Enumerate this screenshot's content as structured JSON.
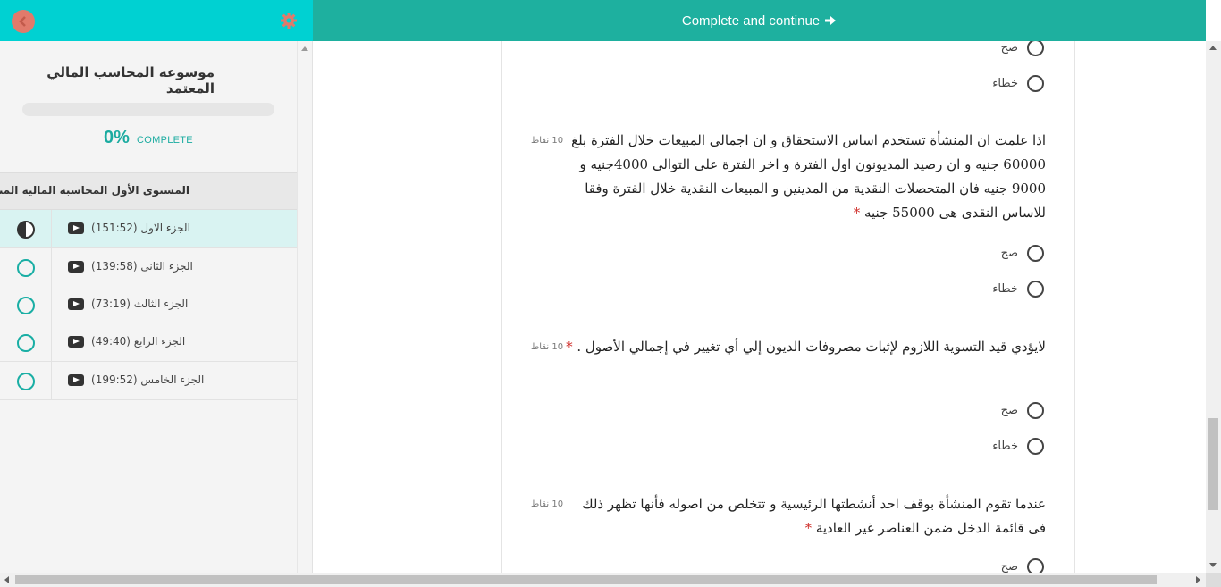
{
  "sidebar": {
    "course_title": "موسوعه المحاسب المالي المعتمد",
    "progress": {
      "percent_value": 0,
      "percent_label": "0%",
      "complete_label": "COMPLETE"
    },
    "section_title": "المستوى الأول المحاسبه الماليه المتقدمه",
    "lessons": [
      {
        "label": "(الجزء الاول (151:52",
        "status": "in-progress"
      },
      {
        "label": "(الجزء الثانى (139:58",
        "status": "not-started"
      },
      {
        "label": "(الجزء الثالث (73:19",
        "status": "not-started"
      },
      {
        "label": "(الجزء الرابع (49:40",
        "status": "not-started"
      },
      {
        "label": "(الجزء الخامس (199:52",
        "status": "not-started"
      }
    ]
  },
  "topbar": {
    "label": "Complete and continue"
  },
  "quiz": {
    "option_true": "صح",
    "option_false": "خطاء",
    "points_label": "10 نقاط",
    "required_mark": "*",
    "questions": [
      {
        "text": "اذا علمت ان المنشأة تستخدم اساس الاستحقاق و ان اجمالى المبيعات خلال الفترة بلغ 60000 جنيه و ان رصيد المديونون اول الفترة و اخر الفترة على التوالى 4000جنيه و 9000 جنيه فان المتحصلات النقدية من المدينين و المبيعات النقدية خلال الفترة وفقا للاساس النقدى هى 55000 جنيه"
      },
      {
        "text": "لايؤدي قيد التسوية اللازوم لإثبات مصروفات الديون إلي أي تغيير في إجمالي الأصول ."
      },
      {
        "text": "عندما تقوم المنشأة بوقف احد أنشطتها الرئيسية و تتخلص من اصوله فأنها تظهر ذلك فى قائمة الدخل ضمن العناصر غير العادية"
      }
    ]
  },
  "colors": {
    "sidebar_header": "#00d1d2",
    "topbar": "#1eb09f",
    "accent": "#19aea4",
    "back_button": "#e17a6b",
    "required": "#d0312d"
  }
}
